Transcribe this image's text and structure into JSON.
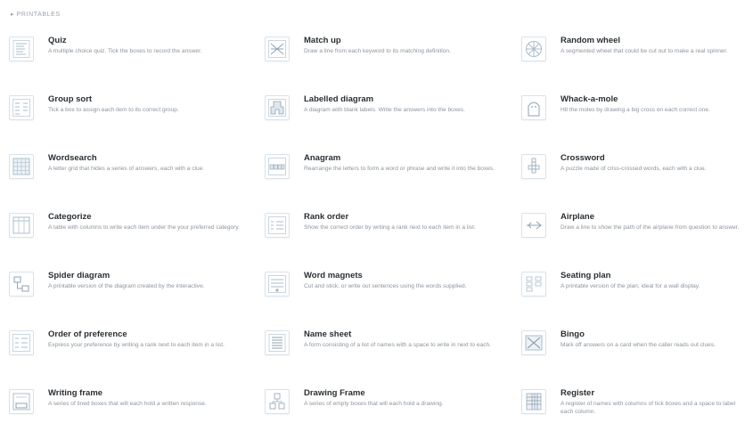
{
  "header": {
    "label": "▸ PRINTABLES"
  },
  "items": [
    {
      "key": "quiz",
      "title": "Quiz",
      "desc": "A multiple choice quiz. Tick the boxes to record the answer.",
      "icon": "quiz-icon"
    },
    {
      "key": "match-up",
      "title": "Match up",
      "desc": "Draw a line from each keyword to its matching definition.",
      "icon": "match-up-icon"
    },
    {
      "key": "random-wheel",
      "title": "Random wheel",
      "desc": "A segmented wheel that could be cut out to make a real spinner.",
      "icon": "random-wheel-icon"
    },
    {
      "key": "group-sort",
      "title": "Group sort",
      "desc": "Tick a box to assign each item to its correct group.",
      "icon": "group-sort-icon"
    },
    {
      "key": "labelled-diagram",
      "title": "Labelled diagram",
      "desc": "A diagram with blank labels. Write the answers into the boxes.",
      "icon": "labelled-diagram-icon"
    },
    {
      "key": "whack-a-mole",
      "title": "Whack-a-mole",
      "desc": "Hit the moles by drawing a big cross on each correct one.",
      "icon": "whack-a-mole-icon"
    },
    {
      "key": "wordsearch",
      "title": "Wordsearch",
      "desc": "A letter grid that hides a series of answers, each with a clue.",
      "icon": "wordsearch-icon"
    },
    {
      "key": "anagram",
      "title": "Anagram",
      "desc": "Rearrange the letters to form a word or phrase and write it into the boxes.",
      "icon": "anagram-icon"
    },
    {
      "key": "crossword",
      "title": "Crossword",
      "desc": "A puzzle made of criss-crossed words, each with a clue.",
      "icon": "crossword-icon"
    },
    {
      "key": "categorize",
      "title": "Categorize",
      "desc": "A table with columns to write each item under the your preferred category.",
      "icon": "categorize-icon"
    },
    {
      "key": "rank-order",
      "title": "Rank order",
      "desc": "Show the correct order by writing a rank next to each item in a list.",
      "icon": "rank-order-icon"
    },
    {
      "key": "airplane",
      "title": "Airplane",
      "desc": "Draw a line to show the path of the airplane from question to answer.",
      "icon": "airplane-icon"
    },
    {
      "key": "spider-diagram",
      "title": "Spider diagram",
      "desc": "A printable version of the diagram created by the interactive.",
      "icon": "spider-diagram-icon"
    },
    {
      "key": "word-magnets",
      "title": "Word magnets",
      "desc": "Cut and stick, or write out sentences using the words supplied.",
      "icon": "word-magnets-icon"
    },
    {
      "key": "seating-plan",
      "title": "Seating plan",
      "desc": "A printable version of the plan, ideal for a wall display.",
      "icon": "seating-plan-icon"
    },
    {
      "key": "order-of-preference",
      "title": "Order of preference",
      "desc": "Express your preference by writing a rank next to each item in a list.",
      "icon": "order-of-preference-icon"
    },
    {
      "key": "name-sheet",
      "title": "Name sheet",
      "desc": "A form consisting of a list of names with a space to write in next to each.",
      "icon": "name-sheet-icon"
    },
    {
      "key": "bingo",
      "title": "Bingo",
      "desc": "Mark off answers on a card when the caller reads out clues.",
      "icon": "bingo-icon"
    },
    {
      "key": "writing-frame",
      "title": "Writing frame",
      "desc": "A series of lined boxes that will each hold a written response.",
      "icon": "writing-frame-icon"
    },
    {
      "key": "drawing-frame",
      "title": "Drawing Frame",
      "desc": "A series of empty boxes that will each hold a drawing.",
      "icon": "drawing-frame-icon"
    },
    {
      "key": "register",
      "title": "Register",
      "desc": "A register of names with columns of tick boxes and a space to label each column.",
      "icon": "register-icon"
    }
  ]
}
